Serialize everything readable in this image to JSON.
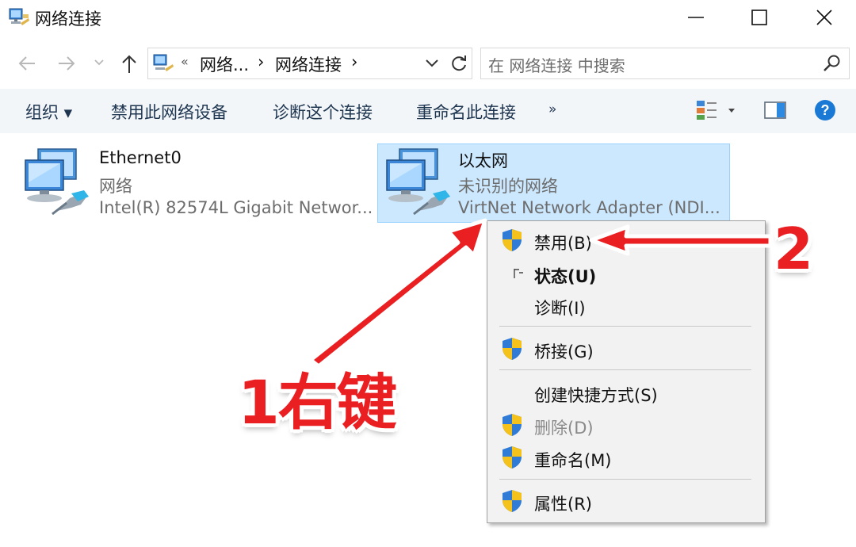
{
  "window": {
    "title": "网络连接",
    "icon": "network-connections-icon",
    "controls": [
      "minimize-icon",
      "maximize-icon",
      "close-icon"
    ]
  },
  "address_bar": {
    "back_icon": "back-arrow-icon",
    "forward_icon": "forward-arrow-icon",
    "recent_icon": "chevron-down-icon",
    "up_icon": "up-arrow-icon",
    "overflow": "«",
    "crumbs": [
      "网络...",
      "网络连接"
    ],
    "separator": "›",
    "refresh_icon": "refresh-icon",
    "search_placeholder": "在 网络连接 中搜索"
  },
  "command_bar": {
    "items": [
      "组织 ▾",
      "禁用此网络设备",
      "诊断这个连接",
      "重命名此连接",
      "»"
    ],
    "view_icon": "change-view-icon",
    "preview_icon": "preview-pane-icon",
    "help_icon": "help-icon"
  },
  "connections": [
    {
      "name": "Ethernet0",
      "status": "网络",
      "device": "Intel(R) 82574L Gigabit Networ...",
      "selected": false
    },
    {
      "name": "以太网",
      "status": "未识别的网络",
      "device": "VirtNet Network Adapter (NDI...",
      "selected": true
    }
  ],
  "context_menu": {
    "items": [
      {
        "label": "禁用(B)",
        "shield": true,
        "bold": false,
        "disabled": false
      },
      {
        "label": "状态(U)",
        "shield": false,
        "bold": true,
        "disabled": false
      },
      {
        "label": "诊断(I)",
        "shield": false,
        "bold": false,
        "disabled": false
      },
      {
        "label": "桥接(G)",
        "shield": true,
        "bold": false,
        "disabled": false
      },
      {
        "label": "创建快捷方式(S)",
        "shield": false,
        "bold": false,
        "disabled": false
      },
      {
        "label": "删除(D)",
        "shield": true,
        "bold": false,
        "disabled": true
      },
      {
        "label": "重命名(M)",
        "shield": true,
        "bold": false,
        "disabled": false
      },
      {
        "label": "属性(R)",
        "shield": true,
        "bold": false,
        "disabled": false
      }
    ]
  },
  "annotations": {
    "label_1": "1右键",
    "label_2": "2",
    "color": "#ea1f22"
  },
  "colors": {
    "selection": "#cce8ff",
    "selection_border": "#99d1ff",
    "command_bar": "#f3f6f9",
    "help_blue": "#1b79d6"
  }
}
